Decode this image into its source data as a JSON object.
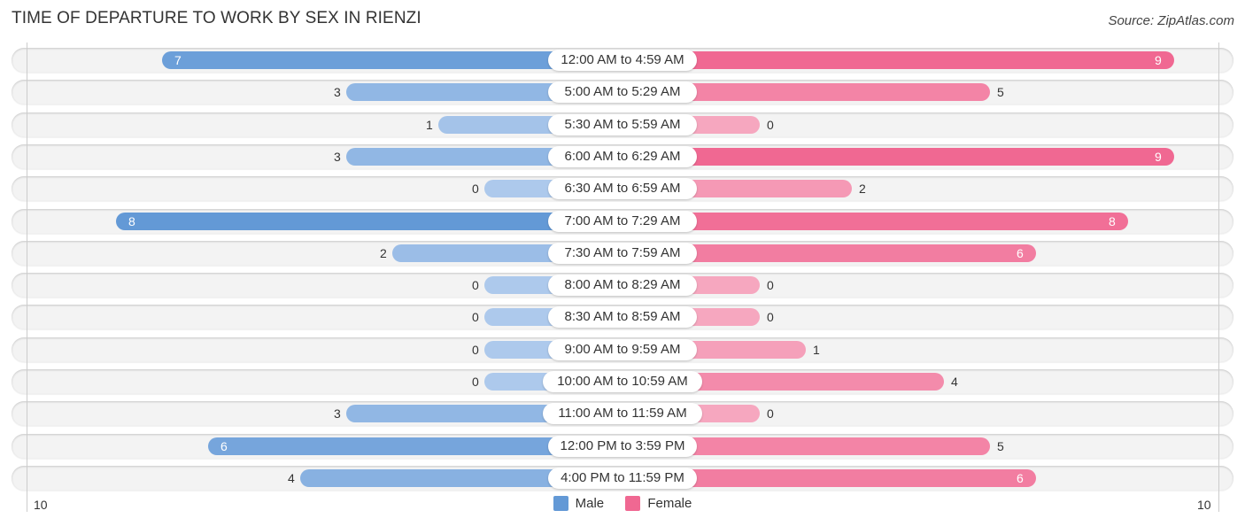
{
  "header": {
    "title": "TIME OF DEPARTURE TO WORK BY SEX IN RIENZI",
    "source": "Source: ZipAtlas.com"
  },
  "colors": {
    "male_strong": "#6399d6",
    "male_light": "#adc9ec",
    "female_strong": "#f06892",
    "female_light": "#f6a7bf"
  },
  "chart_data": {
    "type": "bar",
    "orientation": "horizontal-diverging",
    "title": "TIME OF DEPARTURE TO WORK BY SEX IN RIENZI",
    "categories": [
      "12:00 AM to 4:59 AM",
      "5:00 AM to 5:29 AM",
      "5:30 AM to 5:59 AM",
      "6:00 AM to 6:29 AM",
      "6:30 AM to 6:59 AM",
      "7:00 AM to 7:29 AM",
      "7:30 AM to 7:59 AM",
      "8:00 AM to 8:29 AM",
      "8:30 AM to 8:59 AM",
      "9:00 AM to 9:59 AM",
      "10:00 AM to 10:59 AM",
      "11:00 AM to 11:59 AM",
      "12:00 PM to 3:59 PM",
      "4:00 PM to 11:59 PM"
    ],
    "series": [
      {
        "name": "Male",
        "values": [
          7,
          3,
          1,
          3,
          0,
          8,
          2,
          0,
          0,
          0,
          0,
          3,
          6,
          4
        ]
      },
      {
        "name": "Female",
        "values": [
          9,
          5,
          0,
          9,
          2,
          8,
          6,
          0,
          0,
          1,
          4,
          0,
          5,
          6
        ]
      }
    ],
    "xlim": [
      10,
      10
    ],
    "axis_tick_left": "10",
    "axis_tick_right": "10",
    "legend": {
      "position": "bottom-center",
      "entries": [
        "Male",
        "Female"
      ]
    }
  }
}
